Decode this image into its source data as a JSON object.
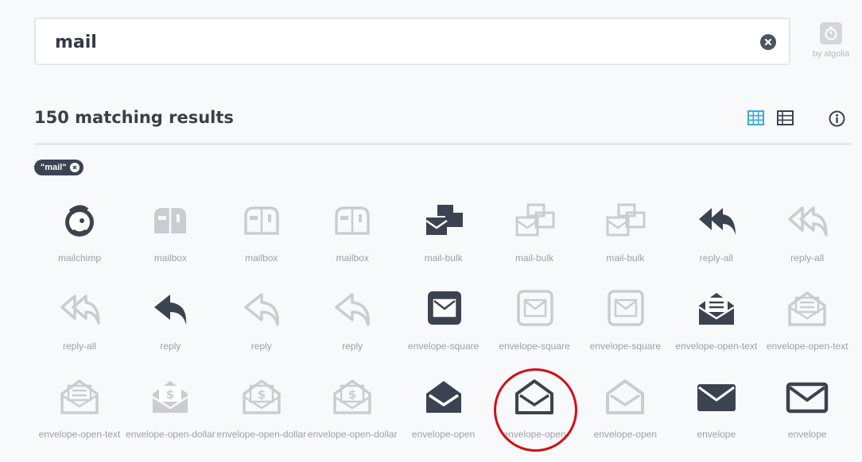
{
  "search": {
    "value": "mail",
    "placeholder": ""
  },
  "algolia": {
    "label": "by algolia"
  },
  "results": {
    "title": "150 matching results"
  },
  "filter": {
    "tag": "\"mail\""
  },
  "colors": {
    "dark": "#3c4350",
    "light": "#c9cdd2",
    "accent": "#3ea7e0",
    "highlight": "#d10e16"
  },
  "icons": [
    {
      "label": "mailchimp",
      "icon": "mailchimp-icon",
      "tone": "dark"
    },
    {
      "label": "mailbox",
      "icon": "mailbox-icon",
      "tone": "solid-light"
    },
    {
      "label": "mailbox",
      "icon": "mailbox-icon",
      "tone": "regular-light"
    },
    {
      "label": "mailbox",
      "icon": "mailbox-icon",
      "tone": "thin-light"
    },
    {
      "label": "mail-bulk",
      "icon": "mail-bulk-icon",
      "tone": "dark"
    },
    {
      "label": "mail-bulk",
      "icon": "mail-bulk-icon",
      "tone": "regular-light"
    },
    {
      "label": "mail-bulk",
      "icon": "mail-bulk-icon",
      "tone": "thin-light"
    },
    {
      "label": "reply-all",
      "icon": "reply-all-icon",
      "tone": "dark"
    },
    {
      "label": "reply-all",
      "icon": "reply-all-icon",
      "tone": "regular-light"
    },
    {
      "label": "reply-all",
      "icon": "reply-all-icon",
      "tone": "thin-light"
    },
    {
      "label": "reply",
      "icon": "reply-icon",
      "tone": "dark"
    },
    {
      "label": "reply",
      "icon": "reply-icon",
      "tone": "regular-light"
    },
    {
      "label": "reply",
      "icon": "reply-icon",
      "tone": "thin-light"
    },
    {
      "label": "envelope-square",
      "icon": "envelope-square-icon",
      "tone": "dark"
    },
    {
      "label": "envelope-square",
      "icon": "envelope-square-icon",
      "tone": "regular-light"
    },
    {
      "label": "envelope-square",
      "icon": "envelope-square-icon",
      "tone": "thin-light"
    },
    {
      "label": "envelope-open-text",
      "icon": "envelope-open-text-icon",
      "tone": "dark"
    },
    {
      "label": "envelope-open-text",
      "icon": "envelope-open-text-icon",
      "tone": "regular-light"
    },
    {
      "label": "envelope-open-text",
      "icon": "envelope-open-text-icon",
      "tone": "thin-light"
    },
    {
      "label": "envelope-open-dollar",
      "icon": "envelope-open-dollar-icon",
      "tone": "solid-light"
    },
    {
      "label": "envelope-open-dollar",
      "icon": "envelope-open-dollar-icon",
      "tone": "regular-light"
    },
    {
      "label": "envelope-open-dollar",
      "icon": "envelope-open-dollar-icon",
      "tone": "thin-light"
    },
    {
      "label": "envelope-open",
      "icon": "envelope-open-icon",
      "tone": "dark"
    },
    {
      "label": "envelope-open",
      "icon": "envelope-open-icon",
      "tone": "regular-dark"
    },
    {
      "label": "envelope-open",
      "icon": "envelope-open-icon",
      "tone": "thin-light"
    },
    {
      "label": "envelope",
      "icon": "envelope-icon",
      "tone": "dark"
    },
    {
      "label": "envelope",
      "icon": "envelope-icon",
      "tone": "regular-dark"
    }
  ]
}
